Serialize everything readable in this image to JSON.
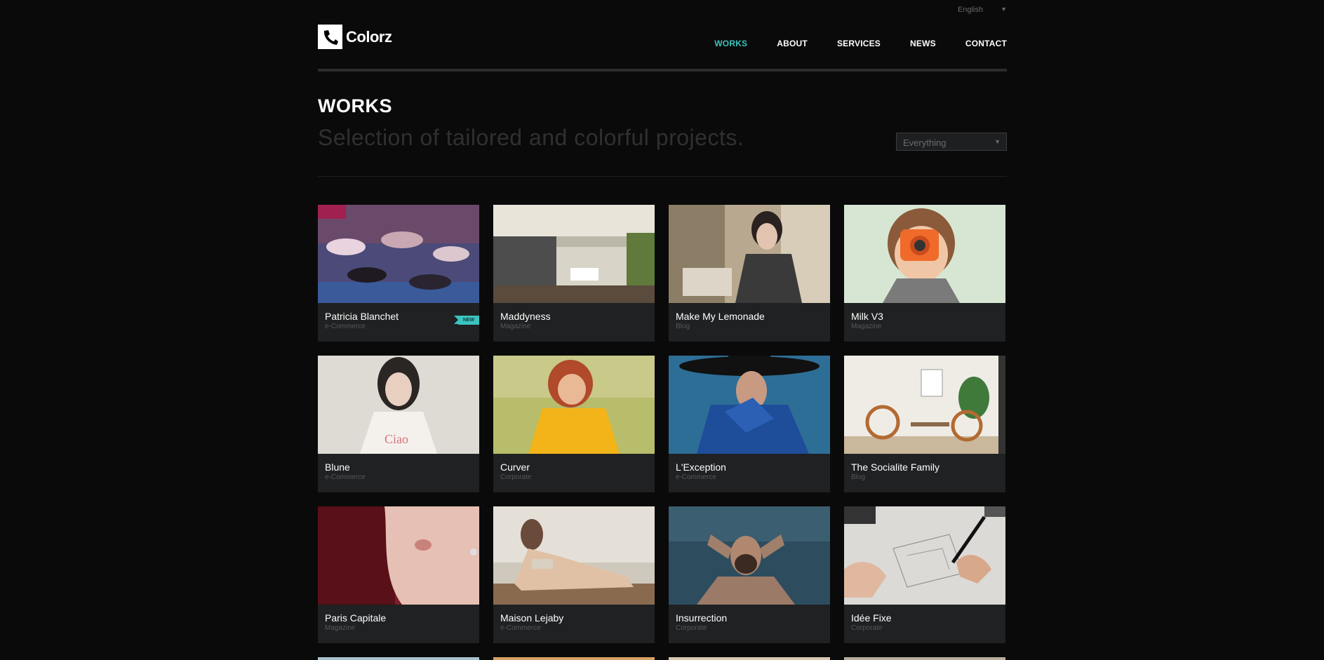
{
  "header": {
    "language": "English",
    "logo_text": "Colorz",
    "nav": [
      {
        "label": "WORKS",
        "active": true
      },
      {
        "label": "ABOUT",
        "active": false
      },
      {
        "label": "SERVICES",
        "active": false
      },
      {
        "label": "NEWS",
        "active": false
      },
      {
        "label": "CONTACT",
        "active": false
      }
    ]
  },
  "page": {
    "title": "WORKS",
    "subtitle": "Selection of tailored and colorful projects.",
    "filter_value": "Everything"
  },
  "colors": {
    "accent": "#3cc3bf",
    "background": "#0a0a0a",
    "card": "#1f2122"
  },
  "works": [
    {
      "title": "Patricia Blanchet",
      "category": "e-Commerce",
      "badge": "NEW"
    },
    {
      "title": "Maddyness",
      "category": "Magazine"
    },
    {
      "title": "Make My Lemonade",
      "category": "Blog"
    },
    {
      "title": "Milk V3",
      "category": "Magazine"
    },
    {
      "title": "Blune",
      "category": "e-Commerce"
    },
    {
      "title": "Curver",
      "category": "Corporate"
    },
    {
      "title": "L'Exception",
      "category": "e-Commerce"
    },
    {
      "title": "The Socialite Family",
      "category": "Blog"
    },
    {
      "title": "Paris Capitale",
      "category": "Magazine"
    },
    {
      "title": "Maison Lejaby",
      "category": "e-Commerce"
    },
    {
      "title": "Insurrection",
      "category": "Corporate"
    },
    {
      "title": "Idée Fixe",
      "category": "Corporate"
    }
  ]
}
